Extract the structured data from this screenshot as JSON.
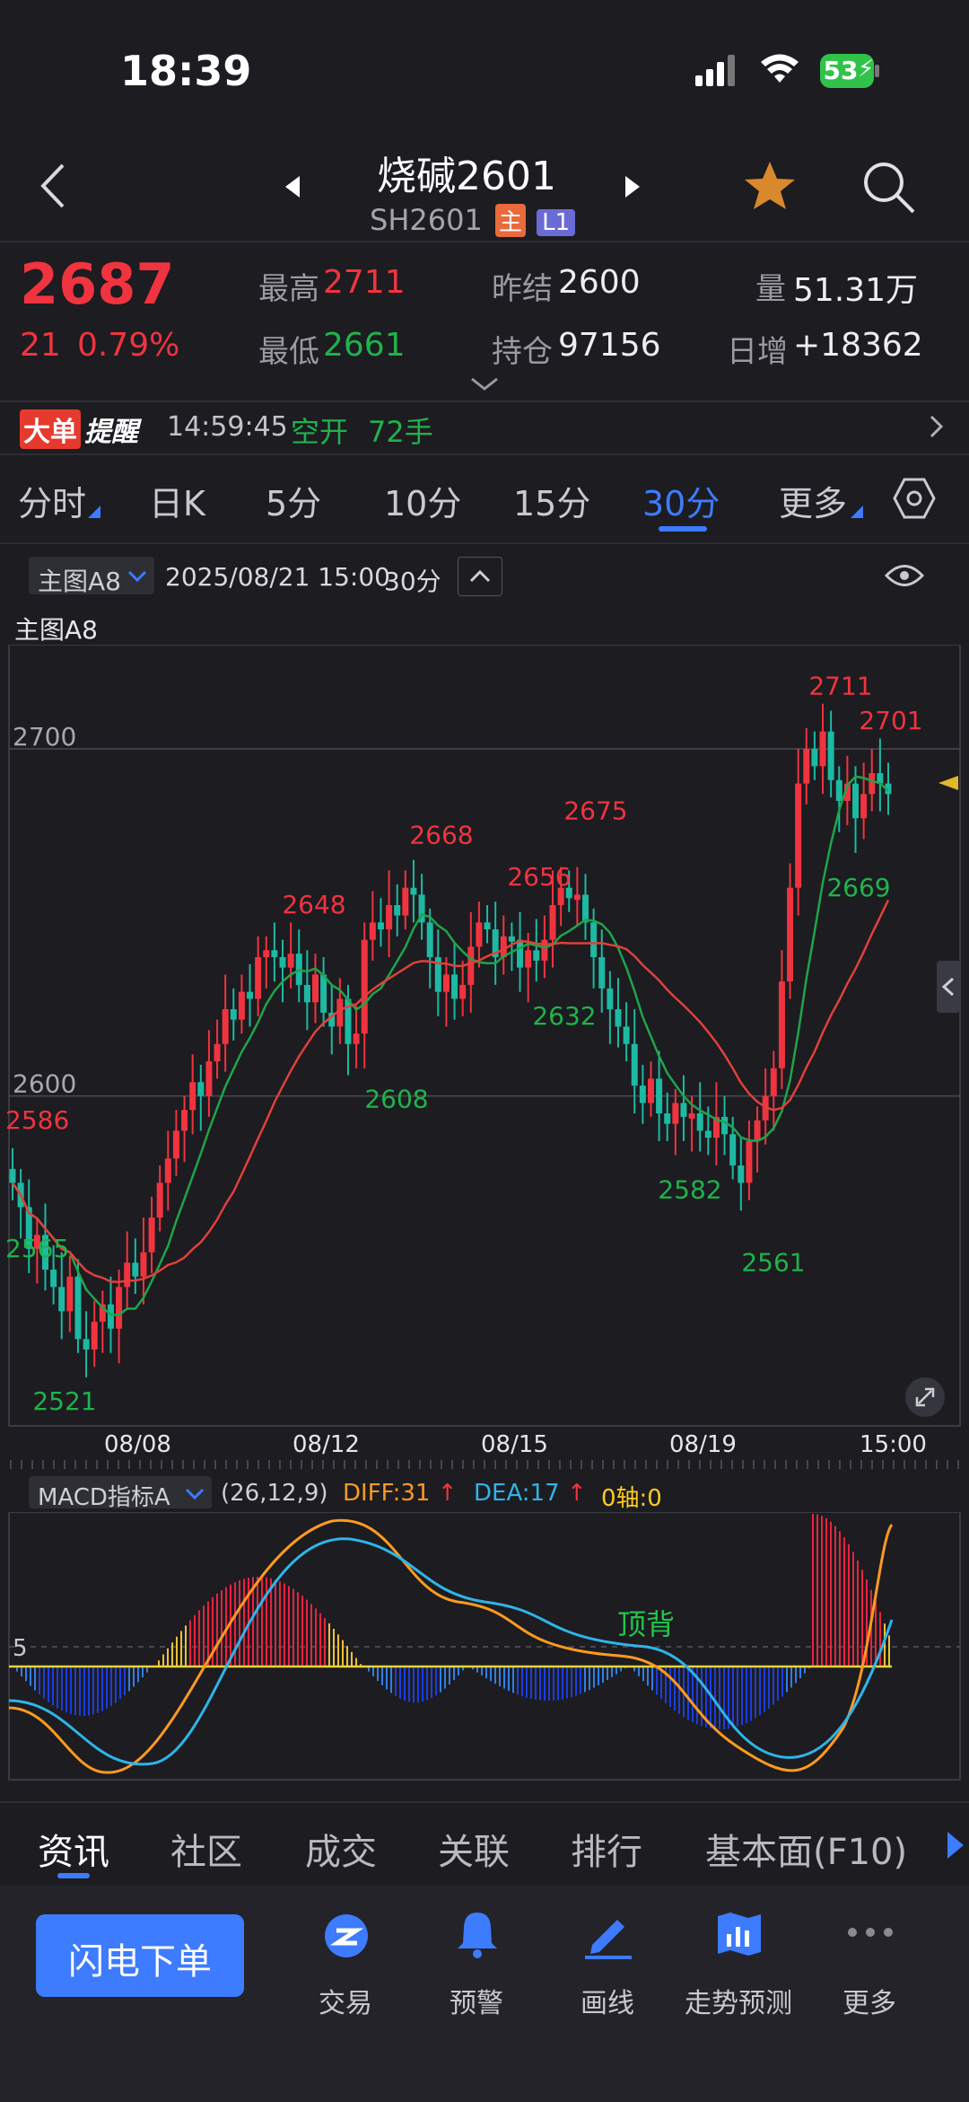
{
  "status_bar": {
    "time": "18:39",
    "battery": "53"
  },
  "header": {
    "title": "烧碱2601",
    "code": "SH2601",
    "badge_main": "主",
    "badge_l1": "L1"
  },
  "quote": {
    "last_price": "2687",
    "change": "21",
    "change_pct": "0.79%",
    "high_label": "最高",
    "high": "2711",
    "low_label": "最低",
    "low": "2661",
    "prev_settle_label": "昨结",
    "prev_settle": "2600",
    "open_interest_label": "持仓",
    "open_interest": "97156",
    "volume_label": "量",
    "volume": "51.31万",
    "daily_inc_label": "日增",
    "daily_inc": "+18362"
  },
  "alert": {
    "tag1": "大单",
    "tag2": "提醒",
    "time": "14:59:45",
    "action": "空开",
    "qty": "72手"
  },
  "period_tabs": [
    "分时",
    "日K",
    "5分",
    "10分",
    "15分",
    "30分",
    "更多"
  ],
  "active_tab_index": 5,
  "chart_header": {
    "indicator": "主图A8",
    "datetime": "2025/08/21 15:00",
    "period": "30分",
    "sub_label": "主图A8"
  },
  "macd_header": {
    "name": "MACD指标A",
    "params": "(26,12,9)",
    "diff": "DIFF:31",
    "dea": "DEA:17",
    "axis": "0轴:0",
    "zero_tick": "5",
    "annotation": "顶背"
  },
  "chart_data": [
    {
      "type": "candlestick",
      "title": "",
      "price_ticks": [
        2700,
        2600
      ],
      "ylim": [
        2505,
        2730
      ],
      "x_labels": [
        "08/08",
        "08/12",
        "08/15",
        "08/19",
        "15:00"
      ],
      "annotations": [
        {
          "text": "2586",
          "value": 2586,
          "kind": "high"
        },
        {
          "text": "2565",
          "value": 2565,
          "kind": "low"
        },
        {
          "text": "2521",
          "value": 2521,
          "kind": "low"
        },
        {
          "text": "2648",
          "value": 2648,
          "kind": "high"
        },
        {
          "text": "2608",
          "value": 2608,
          "kind": "low"
        },
        {
          "text": "2668",
          "value": 2668,
          "kind": "high"
        },
        {
          "text": "2656",
          "value": 2656,
          "kind": "high"
        },
        {
          "text": "2632",
          "value": 2632,
          "kind": "low"
        },
        {
          "text": "2675",
          "value": 2675,
          "kind": "high"
        },
        {
          "text": "2582",
          "value": 2582,
          "kind": "low"
        },
        {
          "text": "2561",
          "value": 2561,
          "kind": "low"
        },
        {
          "text": "2711",
          "value": 2711,
          "kind": "high"
        },
        {
          "text": "2701",
          "value": 2701,
          "kind": "high"
        },
        {
          "text": "2669",
          "value": 2669,
          "kind": "low"
        }
      ],
      "closes": [
        2575,
        2568,
        2556,
        2560,
        2550,
        2545,
        2538,
        2548,
        2530,
        2527,
        2535,
        2540,
        2533,
        2545,
        2552,
        2548,
        2555,
        2565,
        2575,
        2582,
        2590,
        2596,
        2604,
        2600,
        2610,
        2615,
        2625,
        2622,
        2630,
        2628,
        2640,
        2642,
        2640,
        2637,
        2641,
        2632,
        2627,
        2635,
        2624,
        2620,
        2628,
        2615,
        2618,
        2645,
        2650,
        2648,
        2655,
        2652,
        2660,
        2658,
        2650,
        2640,
        2630,
        2635,
        2628,
        2632,
        2643,
        2650,
        2648,
        2640,
        2646,
        2645,
        2637,
        2642,
        2639,
        2645,
        2655,
        2660,
        2657,
        2658,
        2650,
        2640,
        2631,
        2625,
        2620,
        2615,
        2603,
        2598,
        2605,
        2595,
        2592,
        2598,
        2594,
        2595,
        2590,
        2588,
        2594,
        2589,
        2580,
        2575,
        2587,
        2593,
        2600,
        2608,
        2633,
        2660,
        2690,
        2700,
        2695,
        2705,
        2691,
        2685,
        2690,
        2680,
        2687,
        2693,
        2690,
        2687
      ],
      "ma_fast_color": "#1fa44a",
      "ma_slow_color": "#e0403a",
      "up_color": "#f0343f",
      "down_color": "#1db9a3"
    },
    {
      "type": "line",
      "title": "MACD指标A",
      "series": [
        {
          "name": "DIFF",
          "value": 31
        },
        {
          "name": "DEA",
          "value": 17
        }
      ],
      "diff_color": "#ff9a1f",
      "dea_color": "#2fb4e8"
    }
  ],
  "bottom_tabs": [
    "资讯",
    "社区",
    "成交",
    "关联",
    "排行",
    "基本面(F10)"
  ],
  "bottom_nav": {
    "order_button": "闪电下单",
    "items": [
      "交易",
      "预警",
      "画线",
      "走势预测",
      "更多"
    ]
  }
}
